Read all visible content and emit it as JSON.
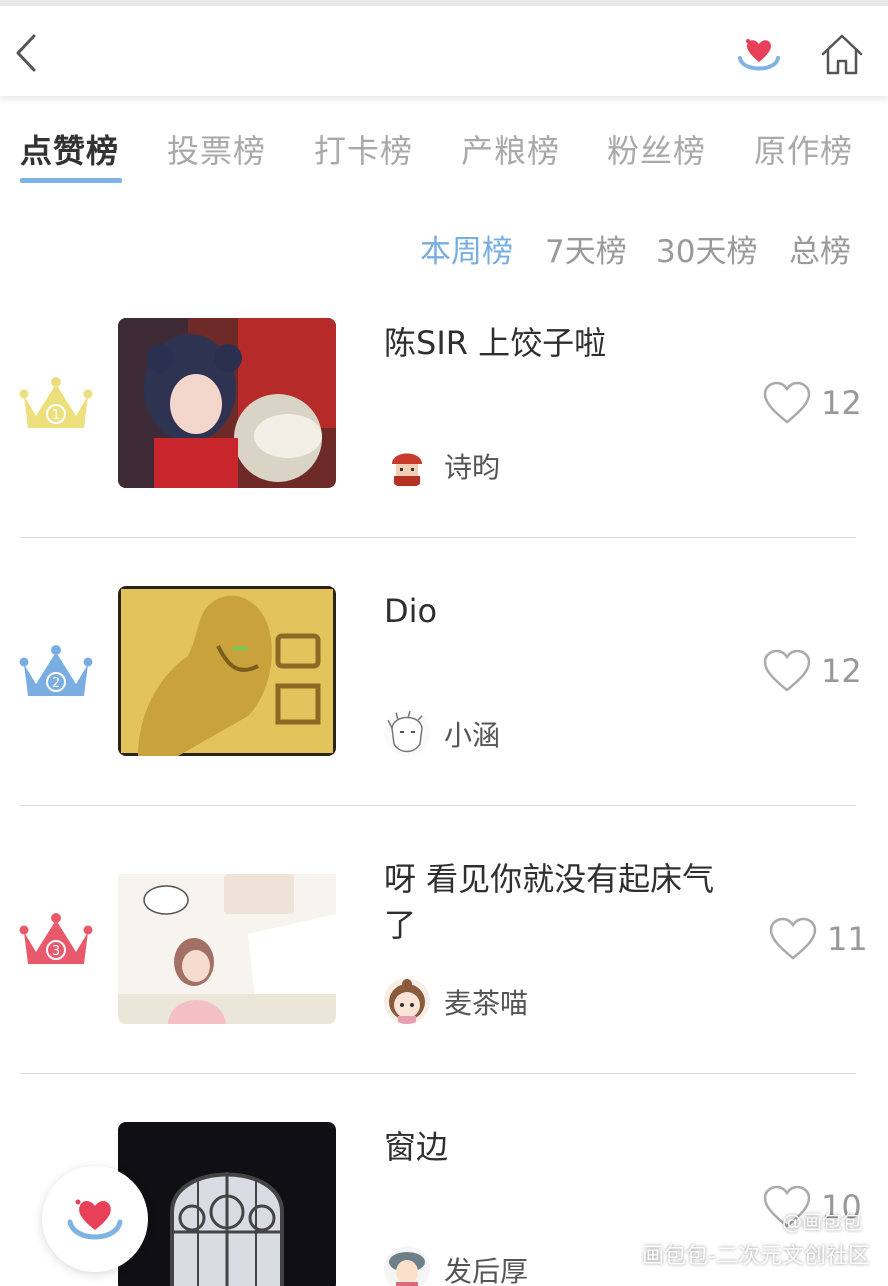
{
  "header": {
    "back_icon": "chevron-left-icon",
    "logo_icon": "huabaobao-logo-icon",
    "home_icon": "home-icon"
  },
  "tabs": [
    {
      "label": "点赞榜",
      "active": true
    },
    {
      "label": "投票榜",
      "active": false
    },
    {
      "label": "打卡榜",
      "active": false
    },
    {
      "label": "产粮榜",
      "active": false
    },
    {
      "label": "粉丝榜",
      "active": false
    },
    {
      "label": "原作榜",
      "active": false
    }
  ],
  "periods": [
    {
      "label": "本周榜",
      "active": true
    },
    {
      "label": "7天榜",
      "active": false
    },
    {
      "label": "30天榜",
      "active": false
    },
    {
      "label": "总榜",
      "active": false
    }
  ],
  "colors": {
    "accent": "#7fb3e3",
    "crown_gold": "#ecdf7c",
    "crown_blue": "#7aaee0",
    "crown_red": "#e85a6b"
  },
  "ranking": [
    {
      "rank": "1",
      "title": "陈SIR 上饺子啦",
      "author": "诗昀",
      "likes": "12",
      "crown": "gold-crown-icon"
    },
    {
      "rank": "2",
      "title": "Dio",
      "author": "小涵",
      "likes": "12",
      "crown": "blue-crown-icon"
    },
    {
      "rank": "3",
      "title": "呀 看见你就没有起床气了",
      "author": "麦茶喵",
      "likes": "11",
      "crown": "red-crown-icon"
    },
    {
      "rank": "",
      "title": "窗边",
      "author": "发后厚",
      "likes": "10",
      "crown": ""
    }
  ],
  "watermark": {
    "line1": "@画包包",
    "line2": "画包包-二次元文创社区"
  }
}
